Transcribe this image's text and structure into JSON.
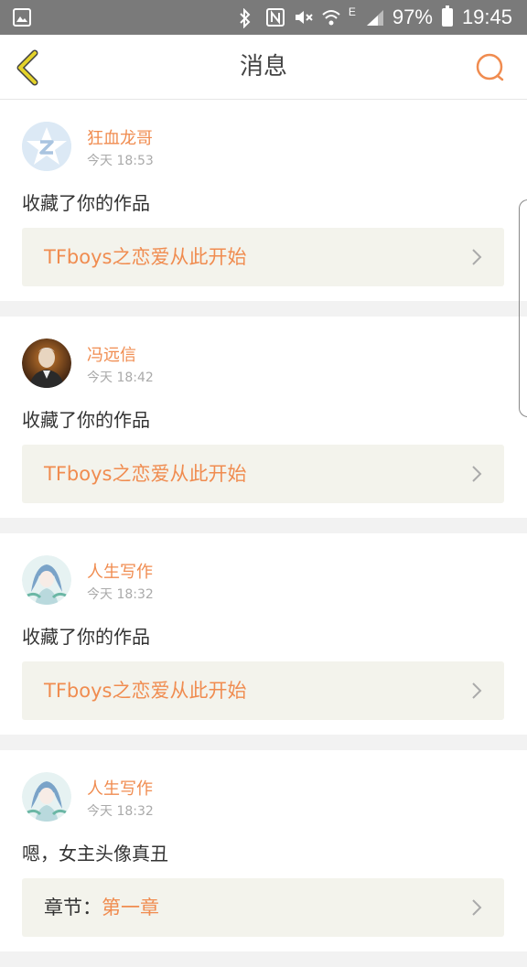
{
  "status_bar": {
    "battery": "97%",
    "time": "19:45",
    "network": "E"
  },
  "header": {
    "title": "消息"
  },
  "messages": [
    {
      "user": "狂血龙哥",
      "time": "今天 18:53",
      "text": "收藏了你的作品",
      "work_prefix": "",
      "work": "TFboys之恋爱从此开始",
      "avatar": "qq-default-avatar"
    },
    {
      "user": "冯远信",
      "time": "今天 18:42",
      "text": "收藏了你的作品",
      "work_prefix": "",
      "work": "TFboys之恋爱从此开始",
      "avatar": "photo-avatar"
    },
    {
      "user": "人生写作",
      "time": "今天 18:32",
      "text": "收藏了你的作品",
      "work_prefix": "",
      "work": "TFboys之恋爱从此开始",
      "avatar": "anime-avatar"
    },
    {
      "user": "人生写作",
      "time": "今天 18:32",
      "text": "嗯，女主头像真丑",
      "work_prefix": "章节：",
      "work": "第一章",
      "avatar": "anime-avatar"
    }
  ],
  "colors": {
    "accent": "#f08c50",
    "back_icon": "#e3d22a"
  }
}
